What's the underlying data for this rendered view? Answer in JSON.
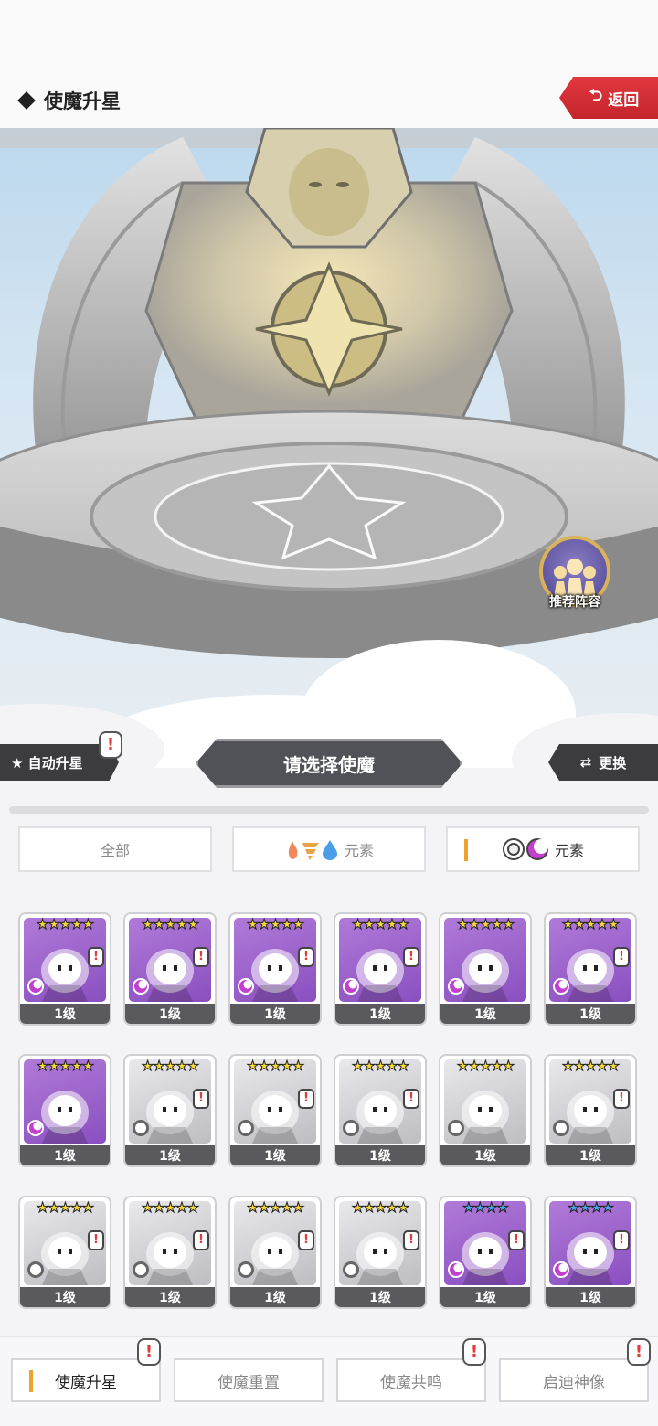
{
  "header": {
    "title": "使魔升星",
    "back_label": "返回",
    "back_icon": "return-arrow"
  },
  "scene": {
    "recommend_label": "推荐阵容"
  },
  "actions": {
    "auto_star_label": "★ 自动升星",
    "select_title": "请选择使魔",
    "swap_label": "更换"
  },
  "filters": [
    {
      "label": "全部",
      "active": false
    },
    {
      "label": "元素",
      "icons": [
        "fire",
        "wind",
        "water"
      ],
      "active": false
    },
    {
      "label": "元素",
      "icons": [
        "light",
        "dark"
      ],
      "active": true
    }
  ],
  "cards": [
    {
      "stars": "★★★★★",
      "star_color": "#f5d83a",
      "level": "1级",
      "element": "dark",
      "alert": true
    },
    {
      "stars": "★★★★★",
      "star_color": "#f5d83a",
      "level": "1级",
      "element": "dark",
      "alert": true
    },
    {
      "stars": "★★★★★",
      "star_color": "#f5d83a",
      "level": "1级",
      "element": "dark",
      "alert": true
    },
    {
      "stars": "★★★★★",
      "star_color": "#f5d83a",
      "level": "1级",
      "element": "dark",
      "alert": true
    },
    {
      "stars": "★★★★★",
      "star_color": "#f5d83a",
      "level": "1级",
      "element": "dark",
      "alert": false
    },
    {
      "stars": "★★★★★",
      "star_color": "#f5d83a",
      "level": "1级",
      "element": "dark",
      "alert": true
    },
    {
      "stars": "★★★★★",
      "star_color": "#f5d83a",
      "level": "1级",
      "element": "dark",
      "alert": false
    },
    {
      "stars": "★★★★★",
      "star_color": "#f5d83a",
      "level": "1级",
      "element": "light",
      "alert": true
    },
    {
      "stars": "★★★★★",
      "star_color": "#f5d83a",
      "level": "1级",
      "element": "light",
      "alert": true
    },
    {
      "stars": "★★★★★",
      "star_color": "#f5d83a",
      "level": "1级",
      "element": "light",
      "alert": true
    },
    {
      "stars": "★★★★★",
      "star_color": "#f5d83a",
      "level": "1级",
      "element": "light",
      "alert": false
    },
    {
      "stars": "★★★★★",
      "star_color": "#f5d83a",
      "level": "1级",
      "element": "light",
      "alert": true
    },
    {
      "stars": "★★★★★",
      "star_color": "#f5d83a",
      "level": "1级",
      "element": "light",
      "alert": true
    },
    {
      "stars": "★★★★★",
      "star_color": "#f5d83a",
      "level": "1级",
      "element": "light",
      "alert": true
    },
    {
      "stars": "★★★★★",
      "star_color": "#f5d83a",
      "level": "1级",
      "element": "light",
      "alert": true
    },
    {
      "stars": "★★★★★",
      "star_color": "#f5d83a",
      "level": "1级",
      "element": "light",
      "alert": true
    },
    {
      "stars": "★★★★",
      "star_color": "#4aa8f0",
      "level": "1级",
      "element": "dark",
      "alert": true
    },
    {
      "stars": "★★★★",
      "star_color": "#4aa8f0",
      "level": "1级",
      "element": "dark",
      "alert": true
    }
  ],
  "tabs": [
    {
      "label": "使魔升星",
      "active": true,
      "alert": true
    },
    {
      "label": "使魔重置",
      "active": false,
      "alert": false
    },
    {
      "label": "使魔共鸣",
      "active": false,
      "alert": true
    },
    {
      "label": "启迪神像",
      "active": false,
      "alert": true
    }
  ],
  "colors": {
    "accent": "#f0a32a",
    "back_red": "#d42b33",
    "alert_red": "#e13b3b",
    "dark_element": "#c23fd0"
  }
}
